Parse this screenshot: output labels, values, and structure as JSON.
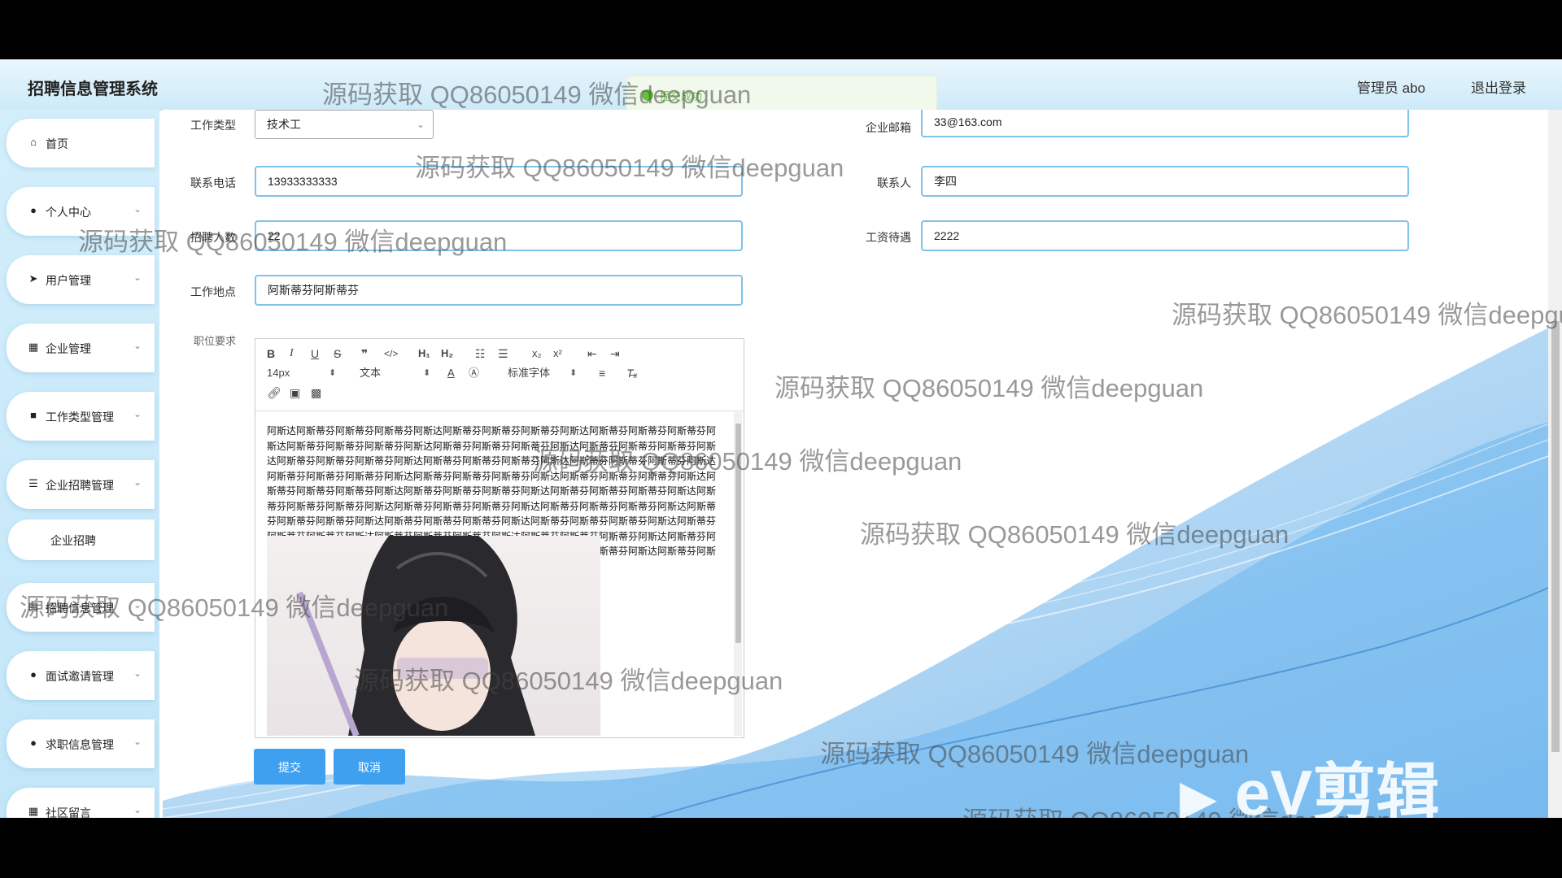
{
  "header": {
    "title": "招聘信息管理系统",
    "user_label": "管理员 abo",
    "logout_label": "退出登录",
    "toast_text": "提交成功"
  },
  "sidebar": {
    "items": [
      {
        "label": "首页",
        "icon": "home-icon"
      },
      {
        "label": "个人中心",
        "icon": "user-icon"
      },
      {
        "label": "用户管理",
        "icon": "send-icon"
      },
      {
        "label": "企业管理",
        "icon": "grid-icon"
      },
      {
        "label": "工作类型管理",
        "icon": "folder-icon"
      },
      {
        "label": "企业招聘管理",
        "icon": "sliders-icon"
      },
      {
        "label": "招聘信息管理",
        "icon": "list-icon"
      },
      {
        "label": "面试邀请管理",
        "icon": "pin-icon"
      },
      {
        "label": "求职信息管理",
        "icon": "user-icon"
      },
      {
        "label": "社区留言",
        "icon": "grid-icon"
      }
    ],
    "sub_item": "企业招聘"
  },
  "form": {
    "job_type_label": "工作类型",
    "job_type_value": "技术工",
    "email_label": "企业邮箱",
    "email_value": "33@163.com",
    "phone_label": "联系电话",
    "phone_value": "13933333333",
    "contact_label": "联系人",
    "contact_value": "李四",
    "headcount_label": "招聘人数",
    "headcount_value": "22",
    "salary_label": "工资待遇",
    "salary_value": "2222",
    "location_label": "工作地点",
    "location_value": "阿斯蒂芬阿斯蒂芬",
    "requirements_label": "职位要求",
    "submit_label": "提交",
    "cancel_label": "取消"
  },
  "editor": {
    "font_size": "14px",
    "text_type": "文本",
    "font_family": "标准字体",
    "content": "阿斯达阿斯蒂芬阿斯蒂芬阿斯蒂芬阿斯达阿斯蒂芬阿斯蒂芬阿斯蒂芬阿斯达阿斯蒂芬阿斯蒂芬阿斯蒂芬阿斯达阿斯蒂芬阿斯蒂芬阿斯蒂芬阿斯达阿斯蒂芬阿斯蒂芬阿斯蒂芬阿斯达阿斯蒂芬阿斯蒂芬阿斯蒂芬阿斯达阿斯蒂芬阿斯蒂芬阿斯蒂芬阿斯达阿斯蒂芬阿斯蒂芬阿斯蒂芬阿斯达阿斯蒂芬阿斯蒂芬阿斯蒂芬阿斯达阿斯蒂芬阿斯蒂芬阿斯蒂芬阿斯达阿斯蒂芬阿斯蒂芬阿斯蒂芬阿斯达阿斯蒂芬阿斯蒂芬阿斯蒂芬阿斯达阿斯蒂芬阿斯蒂芬阿斯蒂芬阿斯达阿斯蒂芬阿斯蒂芬阿斯蒂芬阿斯达阿斯蒂芬阿斯蒂芬阿斯蒂芬阿斯达阿斯蒂芬阿斯蒂芬阿斯蒂芬阿斯达阿斯蒂芬阿斯蒂芬阿斯蒂芬阿斯达阿斯蒂芬阿斯蒂芬阿斯蒂芬阿斯达阿斯蒂芬阿斯蒂芬阿斯蒂芬阿斯达阿斯蒂芬阿斯蒂芬阿斯蒂芬阿斯达阿斯蒂芬阿斯蒂芬阿斯蒂芬阿斯达阿斯蒂芬阿斯蒂芬阿斯蒂芬阿斯达阿斯蒂芬阿斯蒂芬阿斯蒂芬阿斯达阿斯蒂芬阿斯蒂芬阿斯蒂芬阿斯达阿斯蒂芬阿斯蒂芬阿斯蒂芬阿斯达阿斯蒂芬阿斯蒂芬阿斯蒂芬阿斯达阿斯蒂芬阿斯蒂芬阿斯蒂芬阿斯达阿斯蒂芬阿斯蒂芬阿斯蒂芬"
  },
  "watermark": {
    "text": "源码获取 QQ86050149 微信deepguan",
    "logo": "eV剪辑"
  },
  "colors": {
    "accent": "#3fa0f0",
    "input_border": "#7fc2ea",
    "sidebar_bg": "#c8e8f8",
    "success": "#67c23a"
  }
}
